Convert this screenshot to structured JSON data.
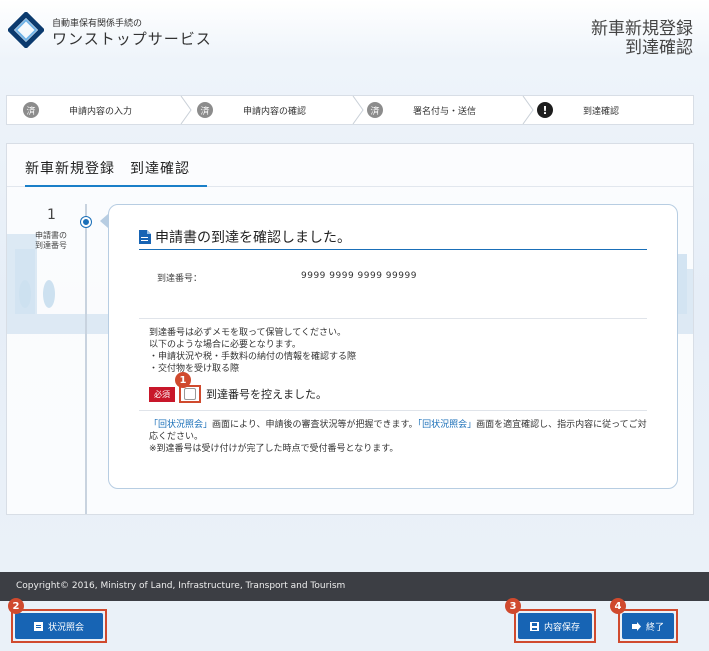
{
  "header": {
    "logo_sub": "自動車保有関係手続の",
    "logo_main": "ワンストップサービス",
    "title_line1": "新車新規登録",
    "title_line2": "到達確認"
  },
  "steps": [
    {
      "badge": "済",
      "label": "申請内容の入力"
    },
    {
      "badge": "済",
      "label": "申請内容の確認"
    },
    {
      "badge": "済",
      "label": "署名付与・送信"
    },
    {
      "badge": "!",
      "label": "到達確認"
    }
  ],
  "panel": {
    "title": "新車新規登録　到達確認",
    "nav_number": "1",
    "nav_label_line1": "申請書の",
    "nav_label_line2": "到達番号"
  },
  "card": {
    "title": "申請書の到達を確認しました。",
    "arrival_label": "到達番号：",
    "arrival_value": "9999 9999 9999 99999",
    "note1": "到達番号は必ずメモを取って保管してください。",
    "note2": "以下のような場合に必要となります。",
    "note3": "・申請状況や税・手数料の納付の情報を確認する際",
    "note4": "・交付物を受け取る際",
    "required_badge": "必須",
    "checkbox_label": "到達番号を控えました。",
    "info_link1": "「回状況照会」",
    "info_text1": "画面により、申請後の審査状況等が把握できます。",
    "info_link2": "「回状況照会」",
    "info_text2": "画面を適宜確認し、指示内容に従ってご対応ください。",
    "info_text3": "※到達番号は受け付けが完了した時点で受付番号となります。"
  },
  "footer": {
    "copyright": "Copyright© 2016, Ministry of Land, Infrastructure, Transport and Tourism"
  },
  "buttons": {
    "status": "状況照会",
    "save": "内容保存",
    "finish": "終了"
  },
  "markers": [
    "1",
    "2",
    "3",
    "4"
  ],
  "colors": {
    "accent": "#1764b4",
    "marker": "#d04a2e",
    "required": "#c8172a",
    "footer": "#3c3e44"
  }
}
